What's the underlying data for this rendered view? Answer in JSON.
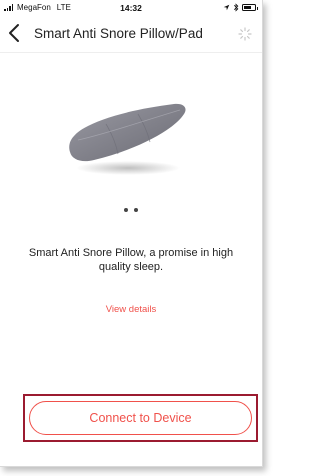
{
  "status_bar": {
    "carrier": "MegaFon",
    "network": "LTE",
    "time": "14:32",
    "icons": [
      "location-arrow-icon",
      "bluetooth-icon",
      "battery-icon"
    ]
  },
  "nav": {
    "title": "Smart Anti Snore Pillow/Pad",
    "back_icon": "chevron-left-icon",
    "loading_icon": "spinner-icon"
  },
  "carousel": {
    "image": "pillow-pad-image",
    "page_count": 2,
    "current_page": 1
  },
  "product": {
    "description": "Smart Anti Snore Pillow, a promise in high quality sleep.",
    "view_details_label": "View details"
  },
  "actions": {
    "connect_label": "Connect to Device"
  },
  "colors": {
    "accent": "#f0514b",
    "highlight_border": "#9b1b30"
  }
}
